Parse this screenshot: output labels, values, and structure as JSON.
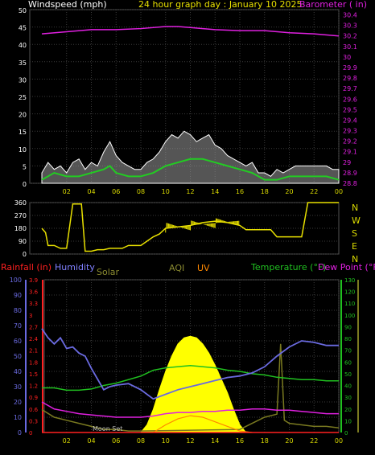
{
  "header": {
    "left_label": "Windspeed (mph)",
    "title": "24 hour graph day : January 10 2025",
    "right_label": "Barometer ( in)"
  },
  "lower_header": {
    "rainfall": "Rainfall (in)",
    "humidity": "Humidity",
    "solar": "Solar",
    "aqi": "AQI",
    "uv": "UV",
    "temperature": "Temperature (°F)",
    "dewpoint": "Dew Point (°F)"
  },
  "annotations": {
    "moon_set": "Moon Set"
  },
  "colors": {
    "wind": "#ffffff",
    "wind_avg": "#22cc22",
    "barometer": "#e020e0",
    "direction": "#e8e000",
    "temperature": "#20c020",
    "humidity": "#6a6ae0",
    "dewpoint": "#e020e0",
    "solar": "#ffff00",
    "uv": "#ff8800",
    "rainfall": "#ff2020",
    "aqi": "#7a7a20",
    "axis_yellow": "#d8d800",
    "grid": "#3a3a3a"
  },
  "chart_data": [
    {
      "type": "line",
      "title": "24 hour graph day : January 10 2025",
      "x_tick_labels": [
        "02",
        "04",
        "06",
        "08",
        "10",
        "12",
        "14",
        "16",
        "18",
        "20",
        "22",
        "00"
      ],
      "left_axis": {
        "label": "Windspeed (mph)",
        "ticks": [
          "0",
          "5",
          "10",
          "15",
          "20",
          "25",
          "30",
          "35",
          "40",
          "45",
          "50"
        ],
        "range": [
          0,
          50
        ]
      },
      "right_axis": {
        "label": "Barometer ( in)",
        "ticks": [
          "28.8",
          "28.9",
          "29",
          "29.1",
          "29.2",
          "29.3",
          "29.4",
          "29.5",
          "29.6",
          "29.7",
          "29.8",
          "29.9",
          "30",
          "30.1",
          "30.2",
          "30.3",
          "30.4"
        ],
        "range": [
          28.8,
          30.45
        ]
      },
      "series": [
        {
          "key": "barometer",
          "x": [
            0,
            2,
            4,
            6,
            8,
            10,
            11,
            12,
            14,
            16,
            18,
            20,
            22,
            24
          ],
          "y": [
            30.22,
            30.24,
            30.26,
            30.26,
            30.27,
            30.29,
            30.29,
            30.28,
            30.26,
            30.25,
            30.25,
            30.23,
            30.22,
            30.2
          ]
        },
        {
          "key": "wind_gust",
          "x": [
            0,
            0.5,
            1,
            1.5,
            2,
            2.5,
            3,
            3.5,
            4,
            4.5,
            5,
            5.5,
            6,
            6.5,
            7,
            7.5,
            8,
            8.5,
            9,
            9.5,
            10,
            10.5,
            11,
            11.5,
            12,
            12.5,
            13,
            13.5,
            14,
            14.5,
            15,
            15.5,
            16,
            16.5,
            17,
            17.5,
            18,
            18.5,
            19,
            19.5,
            20,
            20.5,
            21,
            21.5,
            22,
            22.5,
            23,
            23.5,
            24
          ],
          "y": [
            3,
            6,
            4,
            5,
            3,
            6,
            7,
            4,
            6,
            5,
            9,
            12,
            8,
            6,
            5,
            4,
            4,
            6,
            7,
            9,
            12,
            14,
            13,
            15,
            14,
            12,
            13,
            14,
            11,
            10,
            8,
            7,
            6,
            5,
            6,
            3,
            3,
            2,
            4,
            3,
            4,
            5,
            5,
            5,
            5,
            5,
            5,
            4,
            4
          ]
        },
        {
          "key": "wind_avg",
          "x": [
            0,
            1,
            2,
            3,
            4,
            5,
            5.5,
            6,
            7,
            8,
            9,
            10,
            11,
            12,
            13,
            14,
            15,
            16,
            17,
            18,
            19,
            20,
            21,
            22,
            23,
            24
          ],
          "y": [
            1,
            3,
            2,
            2,
            3,
            4,
            5,
            3,
            2,
            2,
            3,
            5,
            6,
            7,
            7,
            6,
            5,
            4,
            3,
            1,
            1,
            2,
            2,
            2,
            2,
            1
          ]
        }
      ]
    },
    {
      "type": "line",
      "title": "",
      "y_axis": {
        "ticks": [
          "0",
          "90",
          "180",
          "270",
          "360"
        ],
        "range": [
          0,
          360
        ]
      },
      "right_labels": [
        "N",
        "W",
        "S",
        "E",
        "N"
      ],
      "series": [
        {
          "key": "direction",
          "x": [
            0,
            0.3,
            0.5,
            1,
            1.5,
            2,
            2.5,
            3,
            3.2,
            3.5,
            4,
            4.5,
            5,
            5.5,
            6,
            6.5,
            7,
            7.5,
            8,
            8.5,
            9,
            9.5,
            10,
            11,
            12,
            13,
            14,
            15,
            16,
            16.5,
            17,
            18,
            18.5,
            19,
            20,
            20.5,
            21,
            21.5,
            22,
            23,
            24
          ],
          "y": [
            180,
            150,
            60,
            60,
            40,
            40,
            350,
            350,
            350,
            20,
            20,
            30,
            30,
            40,
            40,
            40,
            60,
            60,
            60,
            90,
            120,
            140,
            180,
            190,
            200,
            220,
            230,
            220,
            200,
            170,
            170,
            170,
            170,
            120,
            120,
            120,
            120,
            360,
            360,
            360,
            360
          ]
        }
      ]
    },
    {
      "type": "line",
      "title": "",
      "x_tick_labels": [
        "02",
        "04",
        "06",
        "08",
        "10",
        "12",
        "14",
        "16",
        "18",
        "20",
        "22",
        "00"
      ],
      "left_axis_humidity": {
        "label": "Humidity",
        "ticks": [
          "0",
          "10",
          "20",
          "30",
          "40",
          "50",
          "60",
          "70",
          "80",
          "90",
          "100"
        ],
        "range": [
          0,
          100
        ]
      },
      "left_axis_rain": {
        "label": "Rainfall (in)",
        "ticks": [
          "0",
          "0.3",
          "0.6",
          "0.9",
          "1.2",
          "1.5",
          "1.8",
          "2.1",
          "2.4",
          "2.7",
          "3",
          "3.3",
          "3.6",
          "3.9"
        ],
        "range": [
          0,
          3.9
        ]
      },
      "right_axis_temp": {
        "label": "Temperature (°F)",
        "ticks": [
          "0",
          "10",
          "20",
          "30",
          "40",
          "50",
          "60",
          "70",
          "80",
          "90",
          "100",
          "110",
          "120",
          "130"
        ],
        "range": [
          0,
          130
        ]
      },
      "series": [
        {
          "key": "humidity",
          "x": [
            0,
            0.5,
            1,
            1.5,
            2,
            2.5,
            3,
            3.5,
            4,
            4.5,
            5,
            5.5,
            6,
            7,
            8,
            9,
            10,
            11,
            12,
            13,
            14,
            15,
            16,
            17,
            18,
            19,
            20,
            21,
            22,
            23,
            24
          ],
          "y": [
            68,
            62,
            58,
            62,
            55,
            56,
            52,
            50,
            42,
            35,
            28,
            30,
            31,
            32,
            28,
            22,
            25,
            28,
            30,
            32,
            34,
            36,
            37,
            39,
            43,
            50,
            56,
            60,
            59,
            57,
            57
          ]
        },
        {
          "key": "temperature",
          "x": [
            0,
            1,
            2,
            3,
            4,
            5,
            6,
            7,
            8,
            9,
            10,
            11,
            12,
            13,
            14,
            15,
            16,
            17,
            18,
            19,
            20,
            21,
            22,
            23,
            24
          ],
          "y": [
            38,
            38,
            36,
            36,
            37,
            40,
            42,
            45,
            48,
            53,
            55,
            56,
            57,
            56,
            55,
            53,
            52,
            50,
            49,
            47,
            46,
            45,
            45,
            44,
            44
          ]
        },
        {
          "key": "dewpoint",
          "x": [
            0,
            1,
            2,
            3,
            4,
            5,
            6,
            7,
            8,
            9,
            10,
            11,
            12,
            13,
            14,
            15,
            16,
            17,
            18,
            19,
            20,
            21,
            22,
            23,
            24
          ],
          "y": [
            26,
            20,
            18,
            16,
            15,
            14,
            13,
            13,
            13,
            14,
            16,
            17,
            17,
            18,
            18,
            19,
            19,
            20,
            20,
            19,
            19,
            18,
            17,
            16,
            16
          ]
        },
        {
          "key": "solar",
          "x": [
            8,
            8.5,
            9,
            9.5,
            10,
            10.5,
            11,
            11.5,
            12,
            12.5,
            13,
            13.5,
            14,
            14.5,
            15,
            15.5,
            16,
            16.5
          ],
          "y": [
            0,
            5,
            15,
            28,
            40,
            50,
            58,
            62,
            63,
            62,
            58,
            52,
            44,
            35,
            26,
            15,
            5,
            0
          ]
        },
        {
          "key": "uv",
          "x": [
            9,
            10,
            11,
            12,
            13,
            14,
            15,
            16,
            17
          ],
          "y": [
            0,
            5,
            9,
            11,
            10,
            7,
            4,
            1,
            0
          ]
        },
        {
          "key": "aqi",
          "x": [
            0,
            1,
            2,
            3,
            4,
            5,
            6,
            7,
            8,
            16,
            17,
            18,
            19,
            19.3,
            19.6,
            20,
            21,
            22,
            23,
            24
          ],
          "y": [
            15,
            10,
            8,
            6,
            4,
            2,
            2,
            1,
            1,
            2,
            6,
            10,
            12,
            58,
            8,
            6,
            5,
            4,
            4,
            3
          ]
        },
        {
          "key": "rainfall",
          "x": [
            0,
            24
          ],
          "y": [
            0,
            0
          ]
        }
      ]
    }
  ]
}
